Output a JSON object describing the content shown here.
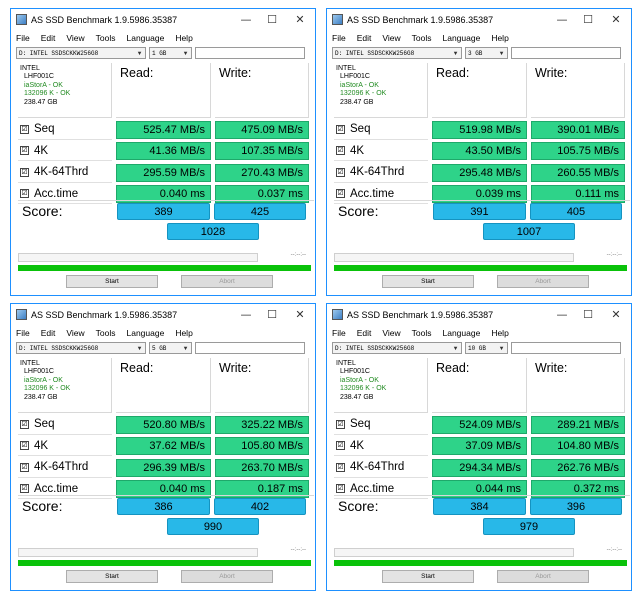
{
  "app": {
    "title": "AS SSD Benchmark 1.9.5986.35387",
    "window_controls": {
      "minimize": "—",
      "maximize": "☐",
      "close": "✕"
    },
    "menu": [
      "File",
      "Edit",
      "View",
      "Tools",
      "Language",
      "Help"
    ],
    "drive": "D: INTEL SSDSCKKW256G8",
    "columns": {
      "read": "Read:",
      "write": "Write:"
    },
    "labels": {
      "seq": "Seq",
      "k4": "4K",
      "k64": "4K-64Thrd",
      "acc": "Acc.time",
      "score": "Score:"
    },
    "checkbox_mark": "☑",
    "dd_arrow": "▼",
    "info": {
      "model": "INTEL",
      "firmware": "LHF001C",
      "driver": "iaStorA - OK",
      "align": "132096 K - OK",
      "capacity": "238.47 GB"
    },
    "time_placeholder": "--:--:--",
    "buttons": {
      "start": "Start",
      "abort": "Abort"
    },
    "status_color": "#0ac20a",
    "result_color": "#2ed389",
    "score_color": "#28b8e8"
  },
  "windows": [
    {
      "size": "1 GB",
      "seq": {
        "read": "525.47 MB/s",
        "write": "475.09 MB/s"
      },
      "k4": {
        "read": "41.36 MB/s",
        "write": "107.35 MB/s"
      },
      "k64": {
        "read": "295.59 MB/s",
        "write": "270.43 MB/s"
      },
      "acc": {
        "read": "0.040 ms",
        "write": "0.037 ms"
      },
      "score": {
        "read": "389",
        "write": "425",
        "total": "1028"
      }
    },
    {
      "size": "3 GB",
      "seq": {
        "read": "519.98 MB/s",
        "write": "390.01 MB/s"
      },
      "k4": {
        "read": "43.50 MB/s",
        "write": "105.75 MB/s"
      },
      "k64": {
        "read": "295.48 MB/s",
        "write": "260.55 MB/s"
      },
      "acc": {
        "read": "0.039 ms",
        "write": "0.111 ms"
      },
      "score": {
        "read": "391",
        "write": "405",
        "total": "1007"
      }
    },
    {
      "size": "5 GB",
      "seq": {
        "read": "520.80 MB/s",
        "write": "325.22 MB/s"
      },
      "k4": {
        "read": "37.62 MB/s",
        "write": "105.80 MB/s"
      },
      "k64": {
        "read": "296.39 MB/s",
        "write": "263.70 MB/s"
      },
      "acc": {
        "read": "0.040 ms",
        "write": "0.187 ms"
      },
      "score": {
        "read": "386",
        "write": "402",
        "total": "990"
      }
    },
    {
      "size": "10 GB",
      "seq": {
        "read": "524.09 MB/s",
        "write": "289.21 MB/s"
      },
      "k4": {
        "read": "37.09 MB/s",
        "write": "104.80 MB/s"
      },
      "k64": {
        "read": "294.34 MB/s",
        "write": "262.76 MB/s"
      },
      "acc": {
        "read": "0.044 ms",
        "write": "0.372 ms"
      },
      "score": {
        "read": "384",
        "write": "396",
        "total": "979"
      }
    }
  ]
}
